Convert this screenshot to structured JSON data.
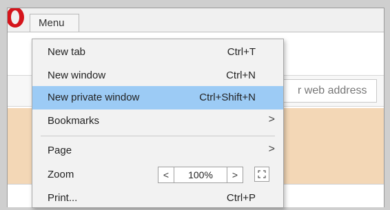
{
  "titlebar": {
    "menu_label": "Menu"
  },
  "address_bar": {
    "placeholder_partial": "r web address"
  },
  "menu": {
    "items": [
      {
        "label": "New tab",
        "shortcut": "Ctrl+T"
      },
      {
        "label": "New window",
        "shortcut": "Ctrl+N"
      },
      {
        "label": "New private window",
        "shortcut": "Ctrl+Shift+N"
      },
      {
        "label": "Bookmarks",
        "arrow": ">"
      },
      {
        "label": "Page",
        "arrow": ">"
      },
      {
        "label": "Zoom"
      },
      {
        "label": "Print...",
        "shortcut": "Ctrl+P"
      }
    ],
    "zoom": {
      "decrease": "<",
      "value": "100%",
      "increase": ">"
    }
  },
  "colors": {
    "highlight": "#9ccbf5",
    "logo_red": "#d5141b"
  },
  "icons": {
    "logo": "opera-logo-icon",
    "fullscreen": "fullscreen-icon"
  }
}
